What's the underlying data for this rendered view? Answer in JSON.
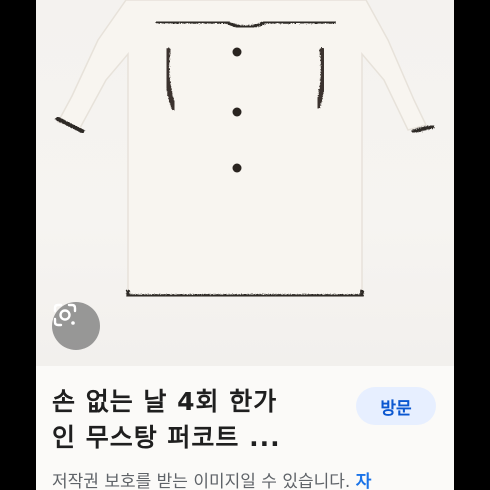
{
  "result": {
    "title_line1": "손 없는 날 4회 한가",
    "title_line2": "인 무스탕 퍼코트 ...",
    "visit_label": "방문",
    "notice_text": "저작권 보호를 받는 이미지일 수 있습니다.",
    "notice_more": "자"
  },
  "icons": {
    "lens": "google-lens-icon"
  },
  "colors": {
    "background": "#000000",
    "card": "#fbfaf8",
    "visit_bg": "#e7efff",
    "visit_text": "#0b57d0",
    "coat": "#f7f4ef",
    "trim": "#2e2925"
  }
}
